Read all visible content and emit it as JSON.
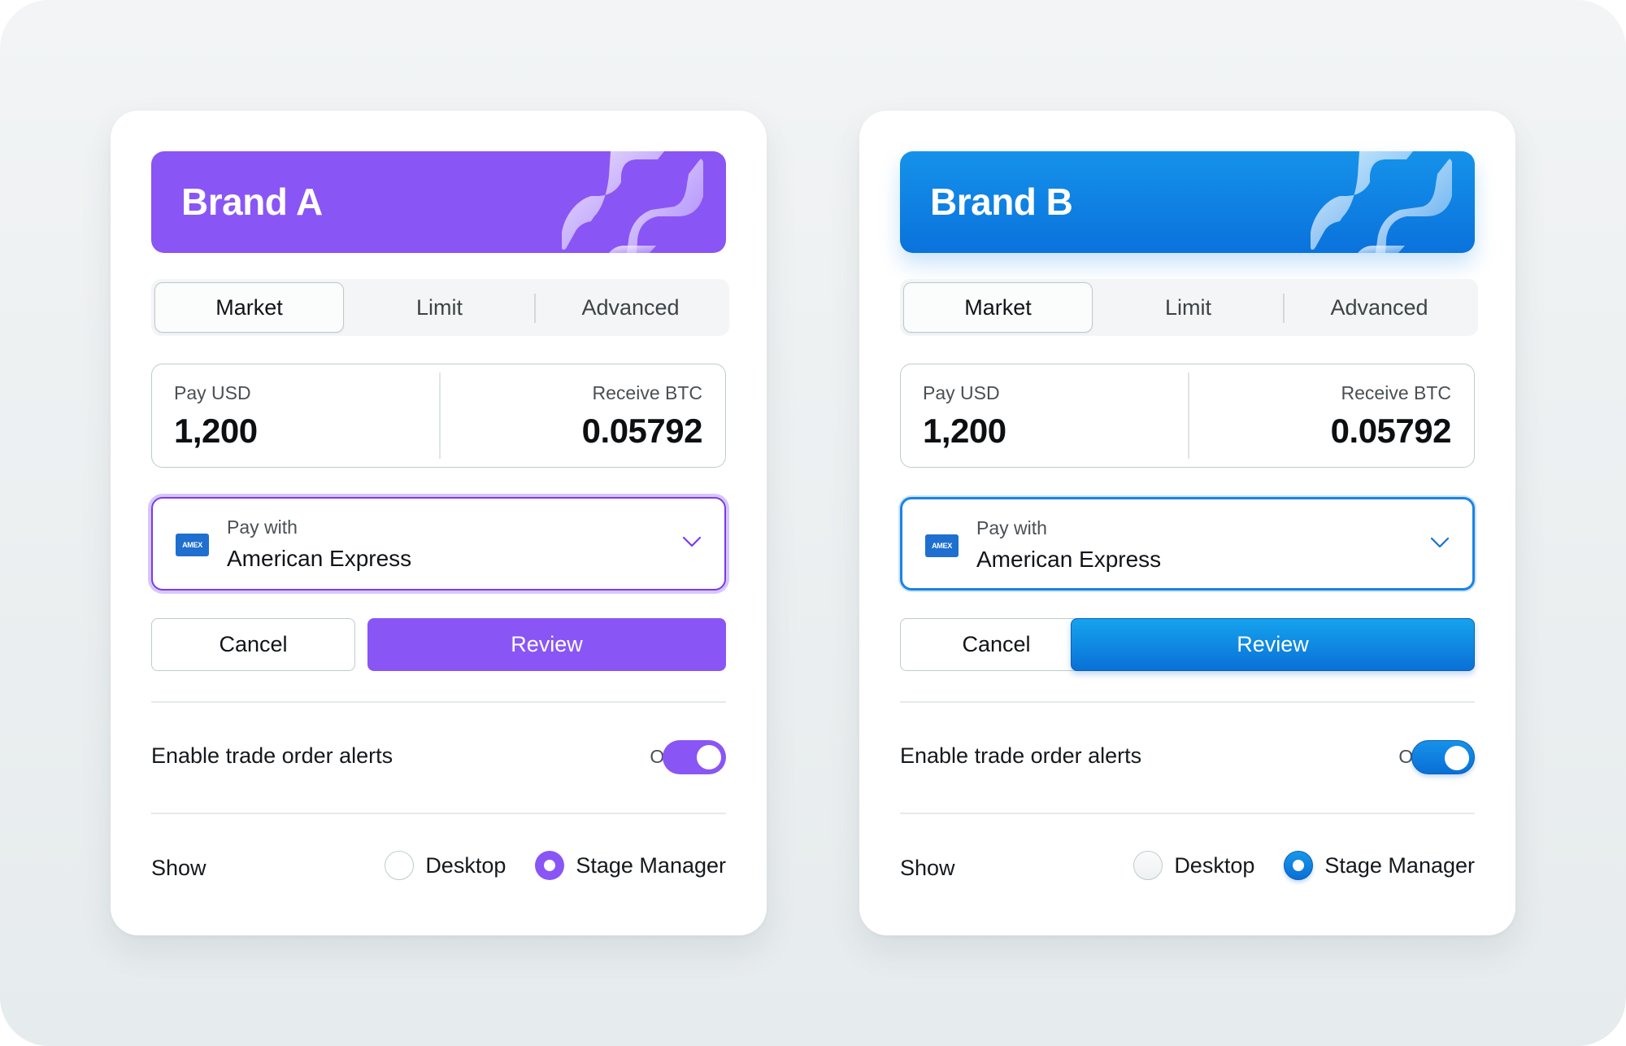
{
  "cards": [
    {
      "id": "a",
      "brand_name": "Brand A",
      "brand_color": "#8a55f5",
      "tabs": [
        {
          "label": "Market",
          "active": true
        },
        {
          "label": "Limit",
          "active": false
        },
        {
          "label": "Advanced",
          "active": false
        }
      ],
      "pay": {
        "label": "Pay USD",
        "value": "1,200"
      },
      "receive": {
        "label": "Receive BTC",
        "value": "0.05792"
      },
      "pay_with": {
        "label": "Pay with",
        "value": "American Express",
        "card_icon_text": "AMEX",
        "icon": "amex-card-icon"
      },
      "buttons": {
        "cancel": "Cancel",
        "review": "Review"
      },
      "toggle": {
        "label": "Enable trade order alerts",
        "state_text": "On",
        "on": true
      },
      "show": {
        "label": "Show",
        "options": [
          {
            "label": "Desktop",
            "selected": false
          },
          {
            "label": "Stage Manager",
            "selected": true
          }
        ]
      }
    },
    {
      "id": "b",
      "brand_name": "Brand B",
      "brand_color": "#0f7fe3",
      "tabs": [
        {
          "label": "Market",
          "active": true
        },
        {
          "label": "Limit",
          "active": false
        },
        {
          "label": "Advanced",
          "active": false
        }
      ],
      "pay": {
        "label": "Pay USD",
        "value": "1,200"
      },
      "receive": {
        "label": "Receive BTC",
        "value": "0.05792"
      },
      "pay_with": {
        "label": "Pay with",
        "value": "American Express",
        "card_icon_text": "AMEX",
        "icon": "amex-card-icon"
      },
      "buttons": {
        "cancel": "Cancel",
        "review": "Review"
      },
      "toggle": {
        "label": "Enable trade order alerts",
        "state_text": "On",
        "on": true
      },
      "show": {
        "label": "Show",
        "options": [
          {
            "label": "Desktop",
            "selected": false
          },
          {
            "label": "Stage Manager",
            "selected": true
          }
        ]
      }
    }
  ]
}
